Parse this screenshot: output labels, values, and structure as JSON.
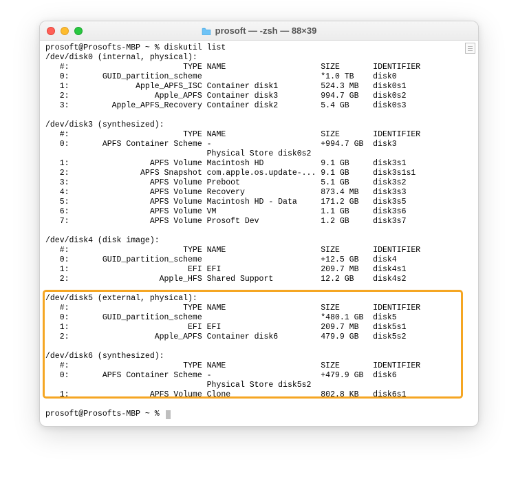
{
  "window": {
    "title": "prosoft — -zsh — 88×39"
  },
  "prompt_user_host": "prosoft@Prosofts-MBP",
  "prompt_path": "~",
  "prompt_symbol": "%",
  "command": "diskutil list",
  "columns": {
    "num": "#:",
    "type": "TYPE",
    "name": "NAME",
    "size": "SIZE",
    "identifier": "IDENTIFIER"
  },
  "disks": [
    {
      "header": "/dev/disk0 (internal, physical):",
      "rows": [
        {
          "num": "0:",
          "type": "GUID_partition_scheme",
          "name": "",
          "size": "*1.0 TB",
          "id": "disk0"
        },
        {
          "num": "1:",
          "type": "Apple_APFS_ISC",
          "name": "Container disk1",
          "size": "524.3 MB",
          "id": "disk0s1"
        },
        {
          "num": "2:",
          "type": "Apple_APFS",
          "name": "Container disk3",
          "size": "994.7 GB",
          "id": "disk0s2"
        },
        {
          "num": "3:",
          "type": "Apple_APFS_Recovery",
          "name": "Container disk2",
          "size": "5.4 GB",
          "id": "disk0s3"
        }
      ]
    },
    {
      "header": "/dev/disk3 (synthesized):",
      "rows": [
        {
          "num": "0:",
          "type": "APFS Container Scheme",
          "name": "-",
          "size": "+994.7 GB",
          "id": "disk3"
        },
        {
          "extra": "Physical Store disk0s2"
        },
        {
          "num": "1:",
          "type": "APFS Volume",
          "name": "Macintosh HD",
          "size": "9.1 GB",
          "id": "disk3s1"
        },
        {
          "num": "2:",
          "type": "APFS Snapshot",
          "name": "com.apple.os.update-...",
          "size": "9.1 GB",
          "id": "disk3s1s1"
        },
        {
          "num": "3:",
          "type": "APFS Volume",
          "name": "Preboot",
          "size": "5.1 GB",
          "id": "disk3s2"
        },
        {
          "num": "4:",
          "type": "APFS Volume",
          "name": "Recovery",
          "size": "873.4 MB",
          "id": "disk3s3"
        },
        {
          "num": "5:",
          "type": "APFS Volume",
          "name": "Macintosh HD - Data",
          "size": "171.2 GB",
          "id": "disk3s5"
        },
        {
          "num": "6:",
          "type": "APFS Volume",
          "name": "VM",
          "size": "1.1 GB",
          "id": "disk3s6"
        },
        {
          "num": "7:",
          "type": "APFS Volume",
          "name": "Prosoft Dev",
          "size": "1.2 GB",
          "id": "disk3s7"
        }
      ]
    },
    {
      "header": "/dev/disk4 (disk image):",
      "rows": [
        {
          "num": "0:",
          "type": "GUID_partition_scheme",
          "name": "",
          "size": "+12.5 GB",
          "id": "disk4"
        },
        {
          "num": "1:",
          "type": "EFI",
          "name": "EFI",
          "size": "209.7 MB",
          "id": "disk4s1"
        },
        {
          "num": "2:",
          "type": "Apple_HFS",
          "name": "Shared Support",
          "size": "12.2 GB",
          "id": "disk4s2"
        }
      ]
    },
    {
      "header": "/dev/disk5 (external, physical):",
      "rows": [
        {
          "num": "0:",
          "type": "GUID_partition_scheme",
          "name": "",
          "size": "*480.1 GB",
          "id": "disk5"
        },
        {
          "num": "1:",
          "type": "EFI",
          "name": "EFI",
          "size": "209.7 MB",
          "id": "disk5s1"
        },
        {
          "num": "2:",
          "type": "Apple_APFS",
          "name": "Container disk6",
          "size": "479.9 GB",
          "id": "disk5s2"
        }
      ]
    },
    {
      "header": "/dev/disk6 (synthesized):",
      "rows": [
        {
          "num": "0:",
          "type": "APFS Container Scheme",
          "name": "-",
          "size": "+479.9 GB",
          "id": "disk6"
        },
        {
          "extra": "Physical Store disk5s2"
        },
        {
          "num": "1:",
          "type": "APFS Volume",
          "name": "Clone",
          "size": "802.8 KB",
          "id": "disk6s1"
        }
      ]
    }
  ]
}
